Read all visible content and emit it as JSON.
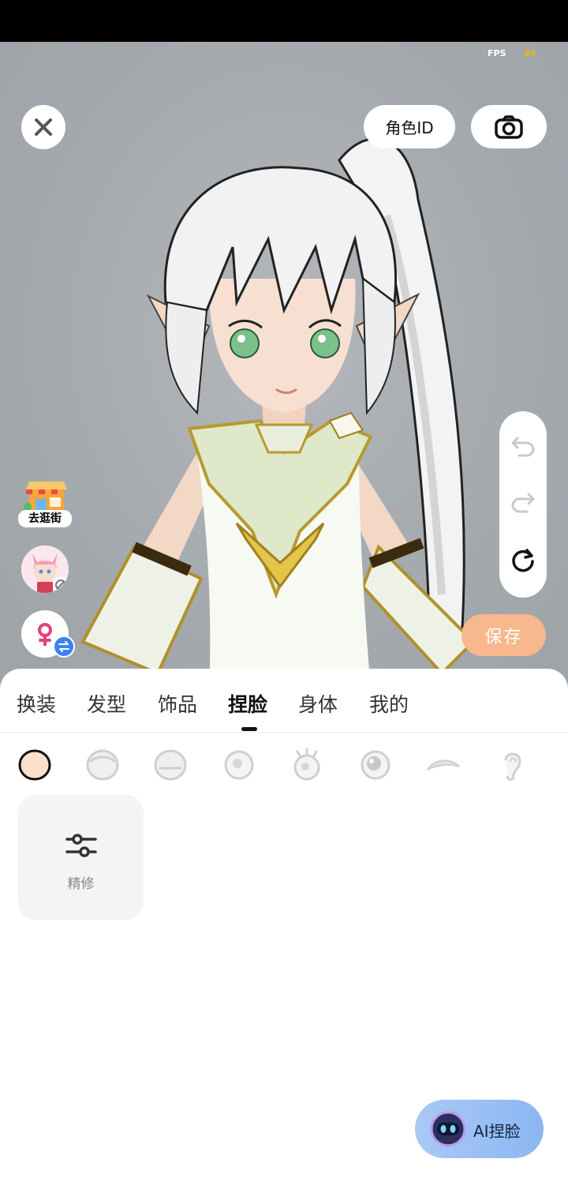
{
  "status": {
    "fps_label": "FPS",
    "fps_value": "24"
  },
  "top": {
    "role_id_label": "角色ID"
  },
  "side": {
    "shop_label": "去逛街"
  },
  "actions": {
    "save_label": "保存",
    "ai_face_label": "AI捏脸"
  },
  "tabs": [
    {
      "label": "换装",
      "active": false
    },
    {
      "label": "发型",
      "active": false
    },
    {
      "label": "饰品",
      "active": false
    },
    {
      "label": "捏脸",
      "active": true
    },
    {
      "label": "身体",
      "active": false
    },
    {
      "label": "我的",
      "active": false
    }
  ],
  "sub_tabs": [
    "face-shape-icon",
    "face-head-icon",
    "face-jaw-icon",
    "eye-icon",
    "eyelash-icon",
    "pupil-icon",
    "eyebrow-icon",
    "ear-icon"
  ],
  "refine": {
    "label": "精修"
  },
  "colors": {
    "accent_save": "#f7b88d",
    "ai_button": "#8cb6f2",
    "gender_female": "#e8407a",
    "swap_badge": "#3b82f6"
  }
}
